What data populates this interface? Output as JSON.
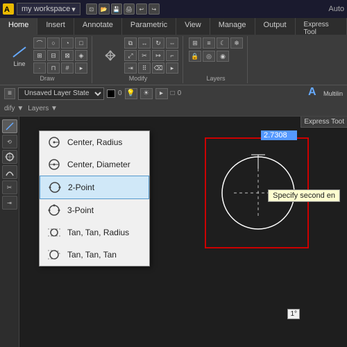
{
  "titlebar": {
    "icon_label": "A",
    "workspace_label": "my workspace",
    "right_label": "Auto",
    "express_toot": "Express Toot"
  },
  "ribbon_tabs": [
    "Home",
    "Insert",
    "Annotate",
    "Parametric",
    "View",
    "Manage",
    "Output",
    "Express Tool"
  ],
  "active_tab": "Home",
  "ribbon_groups": {
    "draw_label": "Draw",
    "modify_label": "Modify",
    "layers_label": "Layers"
  },
  "properties_bar": {
    "layer_state_label": "Unsaved Layer State",
    "color_label": "□",
    "lineweight": "0"
  },
  "layers_bar": {
    "modify_label": "dify ▼",
    "layers_label": "Layers ▼"
  },
  "left_toolbar": {
    "line_label": "Line",
    "multiline_label": "Multilin"
  },
  "dropdown_menu": {
    "items": [
      {
        "id": "center-radius",
        "label": "Center, Radius",
        "icon": "circle"
      },
      {
        "id": "center-diameter",
        "label": "Center, Diameter",
        "icon": "circle-d"
      },
      {
        "id": "2-point",
        "label": "2-Point",
        "icon": "circle",
        "selected": true
      },
      {
        "id": "3-point",
        "label": "3-Point",
        "icon": "circle"
      },
      {
        "id": "tan-tan-radius",
        "label": "Tan, Tan, Radius",
        "icon": "circle-t"
      },
      {
        "id": "tan-tan-tan",
        "label": "Tan, Tan, Tan",
        "icon": "circle-t2"
      }
    ]
  },
  "canvas": {
    "dimension_value": "2.7308",
    "angle_value": "1°",
    "tooltip_text": "Specify second en",
    "circle_visible": true
  }
}
